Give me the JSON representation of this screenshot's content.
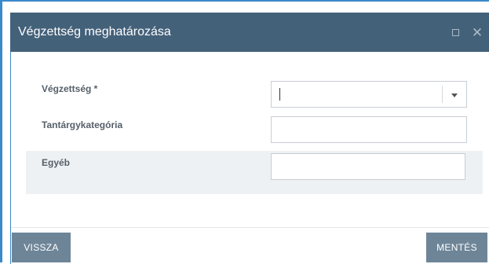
{
  "dialog": {
    "title": "Végzettség meghatározása"
  },
  "form": {
    "fields": [
      {
        "label": "Végzettség *",
        "type": "select",
        "value": ""
      },
      {
        "label": "Tantárgykategória",
        "type": "text",
        "value": ""
      },
      {
        "label": "Egyéb",
        "type": "text",
        "value": ""
      }
    ]
  },
  "footer": {
    "back_label": "VISSZA",
    "save_label": "MENTÉS"
  },
  "icons": {
    "maximize": "maximize-icon",
    "close": "close-icon",
    "dropdown": "chevron-down-icon"
  },
  "colors": {
    "titlebar": "#44617a",
    "accent_border": "#3a89c9",
    "button": "#6e8598",
    "alt_row": "#eef1f4"
  }
}
